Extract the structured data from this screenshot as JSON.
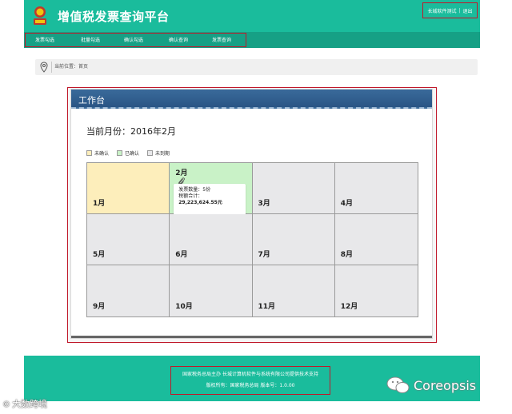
{
  "header": {
    "title": "增值税发票查询平台",
    "links": [
      "长城软件测试",
      "退出"
    ],
    "link_separator": "|"
  },
  "nav": {
    "items": [
      "发票勾选",
      "批量勾选",
      "确认勾选",
      "确认查询",
      "发票查询"
    ]
  },
  "breadcrumb": {
    "text": "当前位置：首页"
  },
  "workbench": {
    "title": "工作台",
    "current_month": "当前月份：2016年2月",
    "legend": [
      {
        "label": "未确认",
        "color": "#fdeebb"
      },
      {
        "label": "已确认",
        "color": "#c9f2c7"
      },
      {
        "label": "未到期",
        "color": "#e8e8ea"
      }
    ],
    "months": [
      "1月",
      "2月",
      "3月",
      "4月",
      "5月",
      "6月",
      "7月",
      "8月",
      "9月",
      "10月",
      "11月",
      "12月"
    ],
    "feb_card": {
      "line1": "发票数量：5份",
      "line2": "税额合计：",
      "line3": "29,223,624.55元"
    }
  },
  "footer": {
    "line1": "国家税务总局主办 长城计算机软件与系统有限公司提供技术支持",
    "line2": "版权所有：国家税务总局 版本号：1.0.00"
  },
  "watermarks": {
    "left": "大数跨境",
    "right": "Coreopsis"
  },
  "colors": {
    "teal": "#1abc9c",
    "highlight_border": "#c0182a",
    "panel_header": "#2a5585"
  }
}
